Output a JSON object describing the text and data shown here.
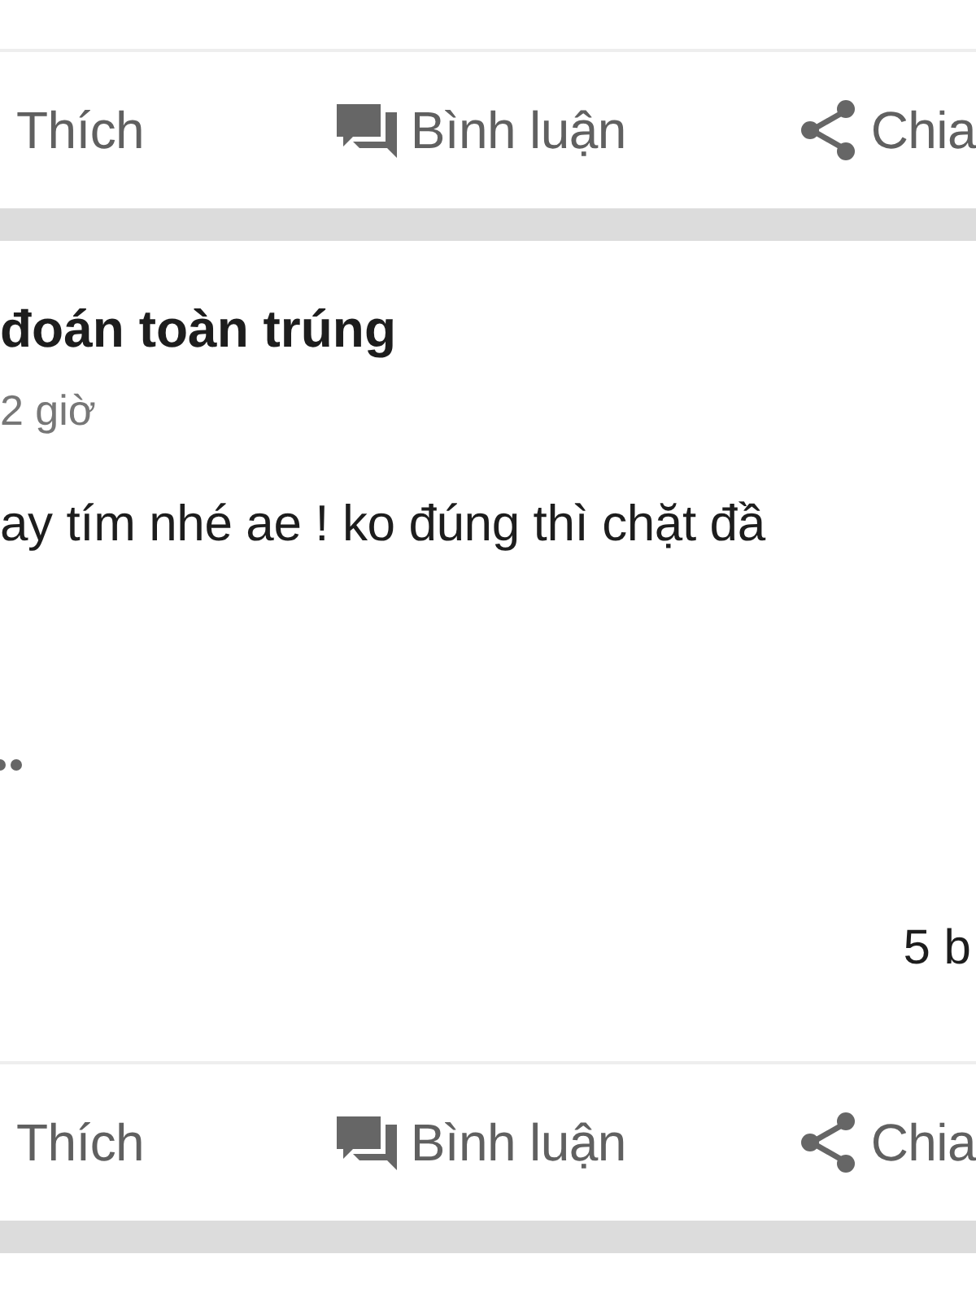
{
  "top_action_bar": {
    "actions": [
      {
        "kind": "like",
        "label": "Thích"
      },
      {
        "kind": "comment",
        "label": "Bình luận"
      },
      {
        "kind": "share",
        "label": "Chia"
      }
    ]
  },
  "post": {
    "title": "đoán toàn trúng",
    "time": "2 giờ",
    "body": "ay tím nhé ae ! ko đúng thì chặt đầ",
    "comment_count": "5 b",
    "action_bar": {
      "actions": [
        {
          "kind": "like",
          "label": "Thích"
        },
        {
          "kind": "comment",
          "label": "Bình luận"
        },
        {
          "kind": "share",
          "label": "Chia"
        }
      ]
    }
  }
}
